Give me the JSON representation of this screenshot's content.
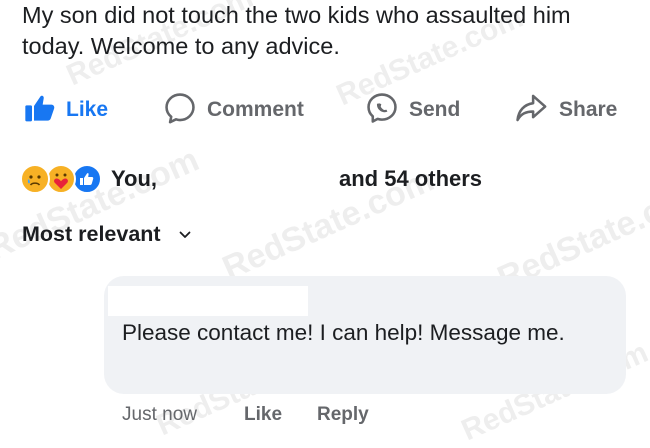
{
  "post": {
    "text": "My son did not touch the two kids who assaulted him today. Welcome to any advice."
  },
  "actions": {
    "like": "Like",
    "comment": "Comment",
    "send": "Send",
    "share": "Share"
  },
  "reactions": {
    "you": "You,",
    "others": "and 54 others",
    "icons": [
      "sad-reaction-icon",
      "care-reaction-icon",
      "like-reaction-icon"
    ]
  },
  "sort": {
    "label": "Most relevant"
  },
  "comment": {
    "text": "Please contact me!  I can help!  Message me.",
    "time": "Just now",
    "like": "Like",
    "reply": "Reply"
  },
  "watermark": "RedState.com",
  "colors": {
    "accent": "#1877f2",
    "secondary_text": "#65676b",
    "bubble": "#f0f2f5"
  }
}
